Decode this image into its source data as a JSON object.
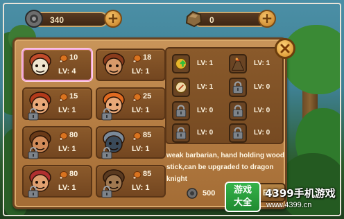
{
  "resources": {
    "gear_amount": "340",
    "stone_amount": "0"
  },
  "units": [
    {
      "name": "skull-helmet-warrior",
      "cost": "10",
      "level": "LV: 4",
      "locked": false,
      "selected": true
    },
    {
      "name": "barbarian-bearded",
      "cost": "18",
      "level": "LV: 1",
      "locked": false,
      "selected": false
    },
    {
      "name": "redhead-girl",
      "cost": "15",
      "level": "LV: 1",
      "locked": true,
      "selected": false
    },
    {
      "name": "orange-hair-girl",
      "cost": "25",
      "level": "LV: 1",
      "locked": true,
      "selected": false
    },
    {
      "name": "lion-mane-warrior",
      "cost": "80",
      "level": "LV: 1",
      "locked": true,
      "selected": false
    },
    {
      "name": "spiked-monster",
      "cost": "85",
      "level": "LV: 1",
      "locked": true,
      "selected": false
    },
    {
      "name": "tusk-helmet-brute",
      "cost": "80",
      "level": "LV: 1",
      "locked": true,
      "selected": false
    },
    {
      "name": "caged-creature",
      "cost": "85",
      "level": "LV: 1",
      "locked": true,
      "selected": false
    }
  ],
  "skills": [
    {
      "icon": "shield-upgrade-icon",
      "level": "LV: 1"
    },
    {
      "icon": "volcano-icon",
      "level": "LV: 1"
    },
    {
      "icon": "compass-icon",
      "level": "LV: 1"
    },
    {
      "icon": "lock-icon",
      "level": "LV: 0"
    },
    {
      "icon": "lock-icon",
      "level": "LV: 0"
    },
    {
      "icon": "lock-icon",
      "level": "LV: 0"
    },
    {
      "icon": "lock-icon",
      "level": "LV: 0"
    },
    {
      "icon": "lock-icon",
      "level": "LV: 0"
    }
  ],
  "description": "weak barbarian, hand holding wood stick,can be upgraded to dragon knight",
  "upgrade": {
    "cost": "500",
    "label": "EAT"
  },
  "watermark": {
    "logo_line1": "游戏",
    "logo_line2": "大全",
    "title": "4399手机游戏",
    "url": "www.4399.cn"
  },
  "colors": {
    "panel": "#b57d43",
    "card": "#7a4b22",
    "selected_border": "#f3a6d9",
    "text": "#fff6e2"
  }
}
